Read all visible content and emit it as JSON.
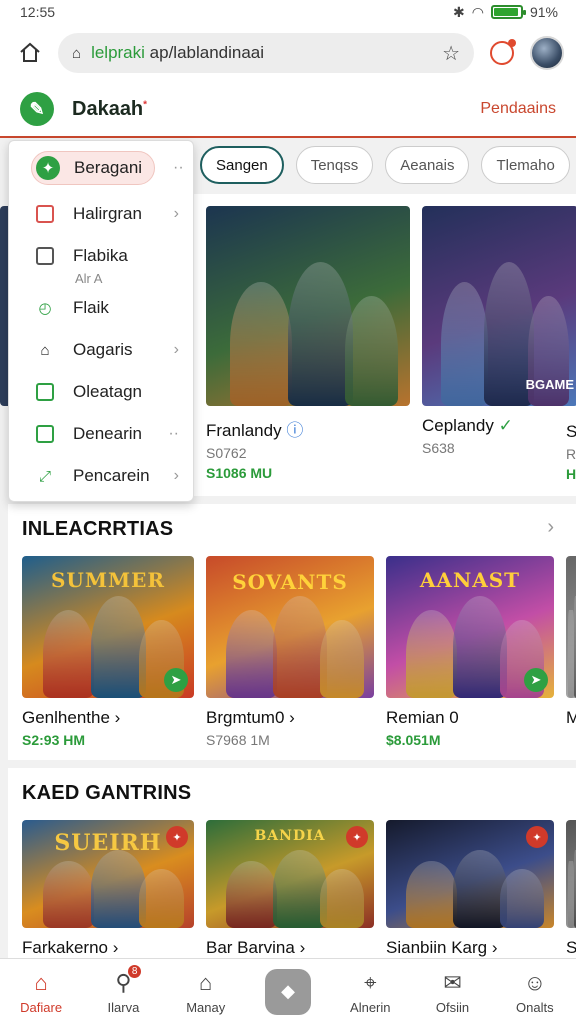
{
  "status_bar": {
    "time": "12:55",
    "battery": "91%",
    "battery_level": 0.91
  },
  "browser": {
    "url_prefix": "lelpraki",
    "url_rest": "ap/lablandinaai"
  },
  "header": {
    "brand": "Dakaah",
    "brand_mark": "*",
    "link": "Pendaains"
  },
  "menu": {
    "items": [
      {
        "label": "Beragani",
        "icon": "compass-icon"
      },
      {
        "label": "Halirgran",
        "icon": "square-icon"
      },
      {
        "label": "Flabika",
        "icon": "doc-icon"
      },
      {
        "label": "Flaik",
        "icon": "timer-icon"
      },
      {
        "label": "Oagaris",
        "icon": "bag-icon"
      },
      {
        "label": "Oleatagn",
        "icon": "image-icon"
      },
      {
        "label": "Denearin",
        "icon": "check-square-icon"
      },
      {
        "label": "Pencarein",
        "icon": "link-icon"
      }
    ],
    "sub_label": "Alr A"
  },
  "chips": [
    "Sangen",
    "Tenqss",
    "Aeanais",
    "Tlemaho"
  ],
  "featured": [
    {
      "title": "Franlandy",
      "sub": "S0762",
      "price": "S1086 MU",
      "colors": [
        "#1c3550",
        "#3c6b3a",
        "#b8732e"
      ]
    },
    {
      "title": "Ceplandy",
      "sub": "S638",
      "price": "",
      "overlay": "BGAME",
      "colors": [
        "#23305a",
        "#5a3a7c",
        "#4c78b9"
      ]
    },
    {
      "title": "S",
      "sub": "R",
      "price": "H",
      "colors": [
        "#444",
        "#666",
        "#888"
      ]
    }
  ],
  "section2": {
    "title": "INLEACRRTIAS",
    "cards": [
      {
        "title": "Genlhenthe",
        "sub": "",
        "price": "S2:93 HM",
        "label": "SUMMER",
        "colors": [
          "#1f5e8c",
          "#d68a1e",
          "#c93a25"
        ]
      },
      {
        "title": "Brgmtum0",
        "sub": "",
        "price": "S7968 1M",
        "label": "SOVANTS",
        "colors": [
          "#c74a2a",
          "#e8a12f",
          "#7a3fa0"
        ]
      },
      {
        "title": "Remian 0",
        "sub": "",
        "price": "$8.051M",
        "label": "AANAST",
        "colors": [
          "#3a2f8a",
          "#c24ea6",
          "#e6b23a"
        ]
      },
      {
        "title": "M",
        "sub": "",
        "price": "",
        "label": "",
        "colors": [
          "#666",
          "#888",
          "#aaa"
        ]
      }
    ]
  },
  "section3": {
    "title": "KAED GANTRINS",
    "cards": [
      {
        "title": "Farkakerno",
        "label": "SUEIRH",
        "colors": [
          "#2a5b8e",
          "#d98d1f",
          "#b6412b"
        ]
      },
      {
        "title": "Bar Barvina",
        "label": "BANDIA",
        "colors": [
          "#2d6d3a",
          "#c79a2a",
          "#8c2f25"
        ]
      },
      {
        "title": "Sianbiin Karg",
        "label": "",
        "colors": [
          "#151a2c",
          "#3c4d8a",
          "#c9862a"
        ]
      },
      {
        "title": "S",
        "label": "",
        "colors": [
          "#555",
          "#777",
          "#999"
        ]
      }
    ]
  },
  "bottom_nav": [
    {
      "label": "Dafiare",
      "icon": "home-icon",
      "active": true
    },
    {
      "label": "Ilarva",
      "icon": "search-icon",
      "badge": "8"
    },
    {
      "label": "Manay",
      "icon": "house-icon"
    },
    {
      "label": "",
      "icon": "bookmark-icon"
    },
    {
      "label": "Alnerin",
      "icon": "map-pin-icon"
    },
    {
      "label": "Ofsiin",
      "icon": "chat-icon"
    },
    {
      "label": "Onalts",
      "icon": "person-icon"
    }
  ]
}
